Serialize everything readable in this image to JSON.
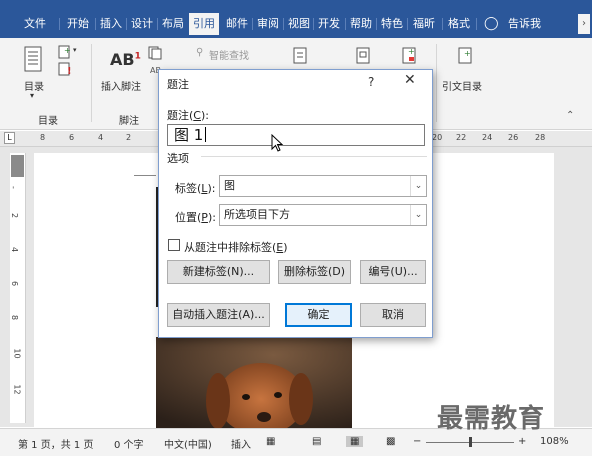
{
  "ribbon_tabs": [
    "文件",
    "开始",
    "插入",
    "设计",
    "布局",
    "引用",
    "邮件",
    "审阅",
    "视图",
    "开发",
    "帮助",
    "特色",
    "福昕",
    "格式",
    "告诉我"
  ],
  "active_tab": "引用",
  "ribbon": {
    "toc_label": "目录",
    "toc_group": "目录",
    "insert_footnote_label": "插入脚注",
    "footnote_group": "脚注",
    "smart_lookup_label": "智能查找",
    "cite_toc_label": "引文目录",
    "ab_glyph": "AB",
    "ab_sup": "1",
    "ab_small": "AB"
  },
  "ruler_numbers": [
    "8",
    "6",
    "4",
    "2",
    "20",
    "22",
    "24",
    "26",
    "28"
  ],
  "ruler_left_marker": "L",
  "vruler_numbers": [
    "-",
    "2",
    "4",
    "6",
    "8",
    "10",
    "12"
  ],
  "dialog": {
    "title": "题注",
    "help": "?",
    "close": "✕",
    "caption_label": "题注(",
    "caption_key": "C",
    "caption_tail": "):",
    "caption_value": "图 1",
    "options_title": "选项",
    "label_label": "标签(",
    "label_key": "L",
    "label_tail": "):",
    "label_value": "图",
    "position_label": "位置(",
    "position_key": "P",
    "position_tail": "):",
    "position_value": "所选项目下方",
    "exclude_label": "从题注中排除标签(",
    "exclude_key": "E",
    "exclude_tail": ")",
    "new_label_btn": "新建标签(N)...",
    "delete_label_btn": "删除标签(D)",
    "numbering_btn": "编号(U)...",
    "autocaption_btn": "自动插入题注(A)...",
    "ok_btn": "确定",
    "cancel_btn": "取消"
  },
  "status": {
    "page": "第 1 页，共 1 页",
    "words": "0 个字",
    "language": "中文(中国)",
    "mode": "插入",
    "zoom": "108%"
  },
  "watermark": "最需教育",
  "colors": {
    "ribbon_blue": "#2b579a",
    "accent": "#0078d7"
  }
}
